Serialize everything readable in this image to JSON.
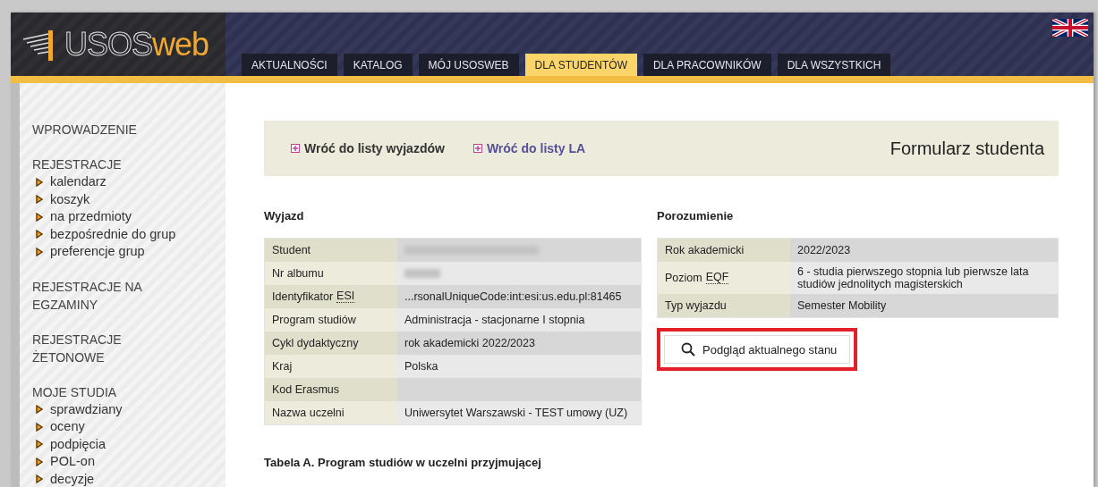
{
  "header": {
    "logo": {
      "part1": "USOS",
      "part2": "web"
    },
    "tabs": [
      {
        "label": "AKTUALNOŚCI",
        "selected": false
      },
      {
        "label": "KATALOG",
        "selected": false
      },
      {
        "label": "MÓJ USOSWEB",
        "selected": false
      },
      {
        "label": "DLA STUDENTÓW",
        "selected": true
      },
      {
        "label": "DLA PRACOWNIKÓW",
        "selected": false
      },
      {
        "label": "DLA WSZYSTKICH",
        "selected": false
      }
    ]
  },
  "sidebar": {
    "sections": [
      {
        "title": "WPROWADZENIE"
      },
      {
        "title": "REJESTRACJE",
        "items": [
          "kalendarz",
          "koszyk",
          "na przedmioty",
          "bezpośrednie do grup",
          "preferencje grup"
        ]
      },
      {
        "title": "REJESTRACJE NA EGZAMINY"
      },
      {
        "title": "REJESTRACJE ŻETONOWE"
      },
      {
        "title": "MOJE STUDIA",
        "items": [
          "sprawdziany",
          "oceny",
          "podpięcia",
          "POL-on",
          "decyzje"
        ]
      }
    ]
  },
  "nav": {
    "links": [
      "Wróć do listy wyjazdów",
      "Wróć do listy LA"
    ],
    "title": "Formularz studenta"
  },
  "wyjazd": {
    "heading": "Wyjazd",
    "rows": [
      {
        "label": "Student",
        "value": "",
        "redacted": true
      },
      {
        "label": "Nr albumu",
        "value": "",
        "redacted": true
      },
      {
        "label": "Identyfikator",
        "abbr": "ESI",
        "value": "...rsonalUniqueCode:int:esi:us.edu.pl:81465",
        "redacted": false
      },
      {
        "label": "Program studiów",
        "value": "Administracja - stacjonarne I stopnia",
        "redacted": false
      },
      {
        "label": "Cykl dydaktyczny",
        "value": "rok akademicki 2022/2023",
        "redacted": false
      },
      {
        "label": "Kraj",
        "value": "Polska",
        "redacted": false
      },
      {
        "label": "Kod Erasmus",
        "value": "",
        "redacted": false
      },
      {
        "label": "Nazwa uczelni",
        "value": "Uniwersytet Warszawski - TEST umowy (UZ)",
        "redacted": false
      }
    ]
  },
  "porozumienie": {
    "heading": "Porozumienie",
    "rows": [
      {
        "label": "Rok akademicki",
        "value": "2022/2023"
      },
      {
        "label": "Poziom",
        "abbr": "EQF",
        "value": "6 - studia pierwszego stopnia lub pierwsze lata studiów jednolitych magisterskich"
      },
      {
        "label": "Typ wyjazdu",
        "value": "Semester Mobility"
      }
    ],
    "button": {
      "label": "Podgląd aktualnego stanu",
      "highlighted": true
    }
  },
  "section_heading": "Tabela A. Program studiów w uczelni przyjmującej"
}
